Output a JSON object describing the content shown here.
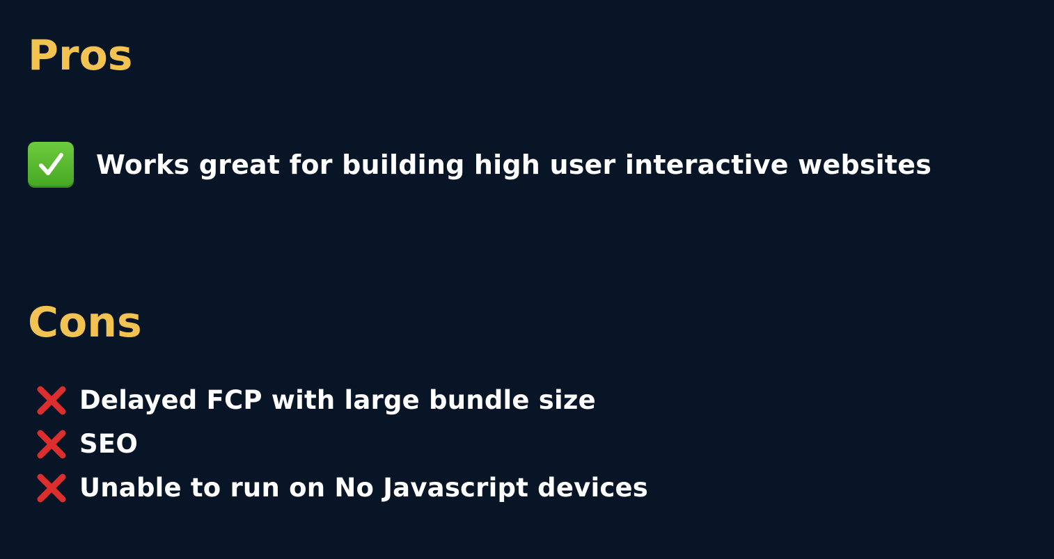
{
  "pros": {
    "heading": "Pros",
    "items": [
      {
        "icon": "check-mark-button-icon",
        "text": "Works great for building high user interactive websites"
      }
    ]
  },
  "cons": {
    "heading": "Cons",
    "items": [
      {
        "icon": "cross-mark-icon",
        "text": "Delayed FCP with large bundle size"
      },
      {
        "icon": "cross-mark-icon",
        "text": "SEO"
      },
      {
        "icon": "cross-mark-icon",
        "text": "Unable to run on No Javascript devices"
      }
    ]
  },
  "colors": {
    "background": "#071527",
    "heading": "#F2C350",
    "text": "#FFFFFF",
    "check": "#5BBA30",
    "cross": "#DD2E2E"
  }
}
